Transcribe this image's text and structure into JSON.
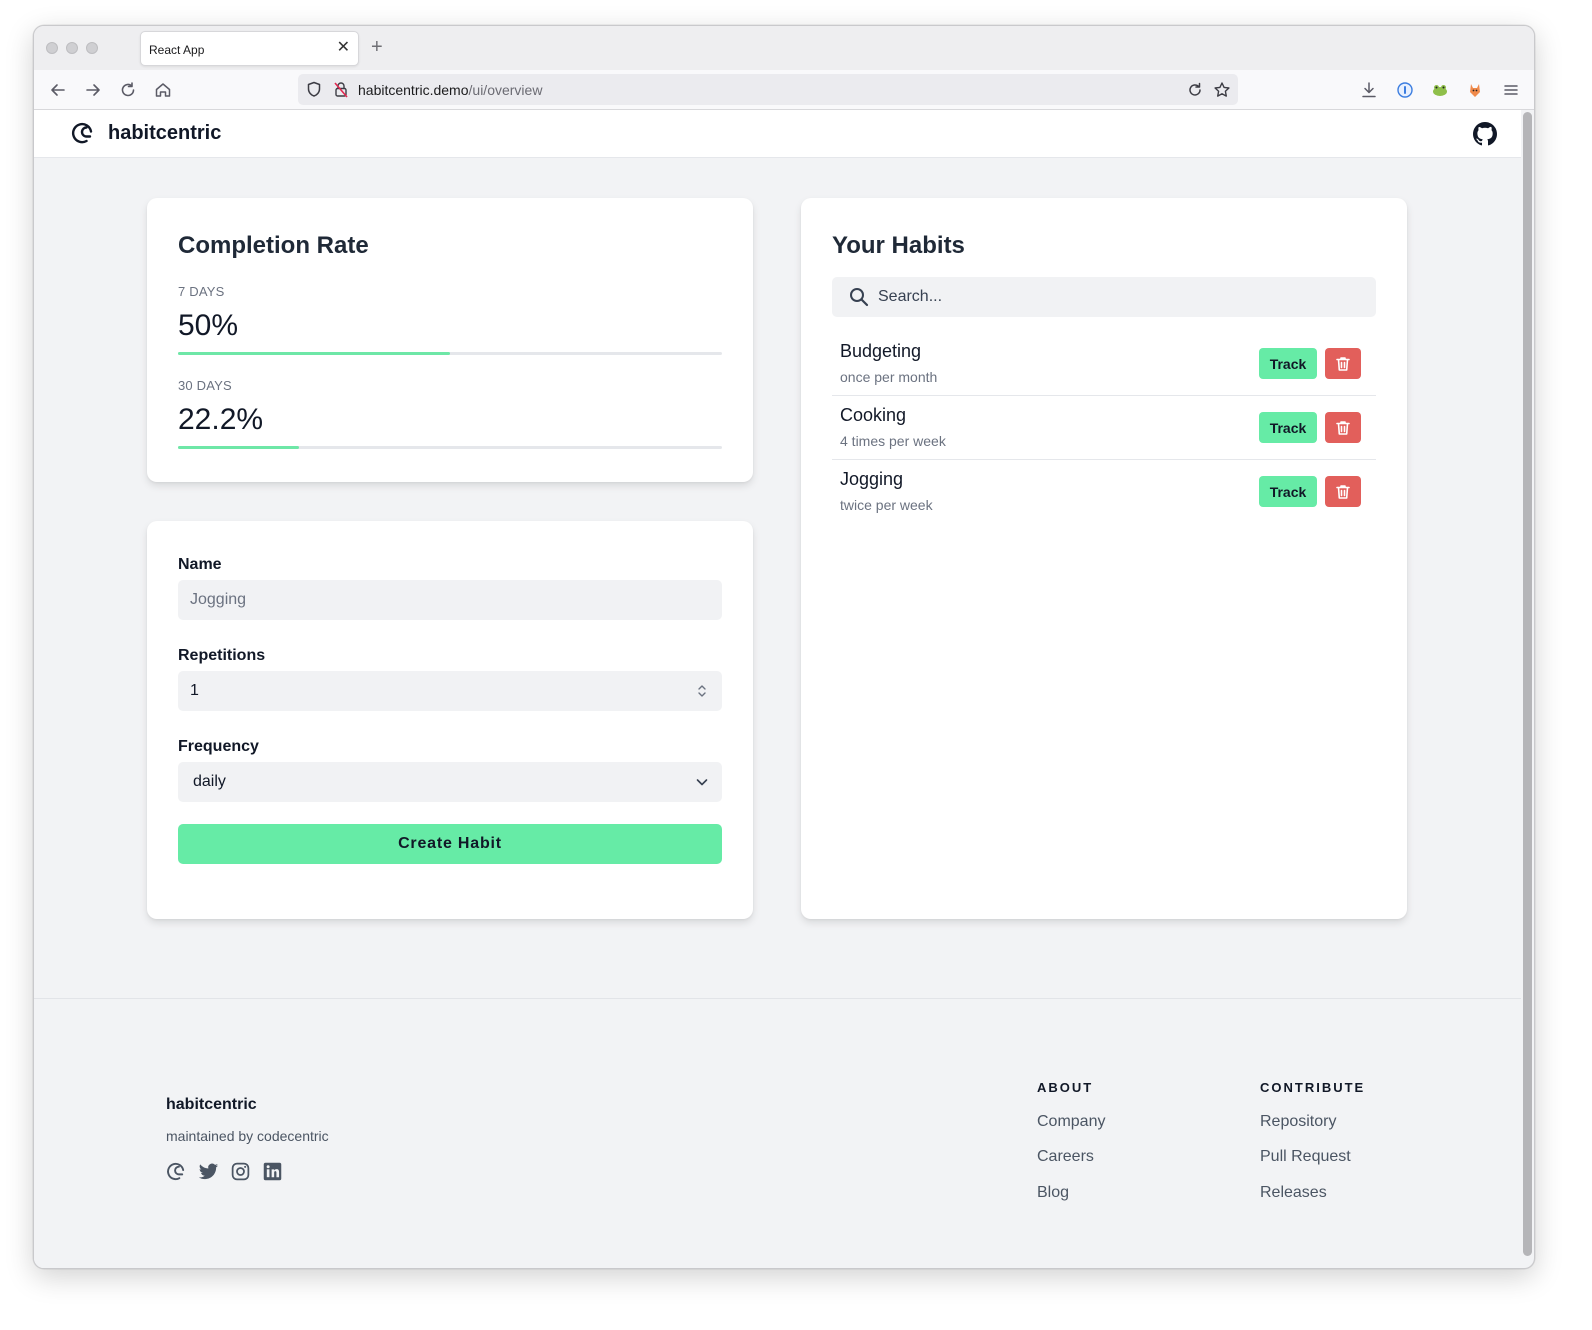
{
  "browser": {
    "tab_title": "React App",
    "tab_close": "✕",
    "new_tab": "+",
    "url_domain": "habitcentric.demo",
    "url_path": "/ui/overview"
  },
  "header": {
    "brand": "habitcentric"
  },
  "completion": {
    "title": "Completion Rate",
    "stats": [
      {
        "label": "7 DAYS",
        "value": "50%",
        "fill": 0.5
      },
      {
        "label": "30 DAYS",
        "value": "22.2%",
        "fill": 0.222
      }
    ]
  },
  "form": {
    "name_label": "Name",
    "name_placeholder": "Jogging",
    "repetitions_label": "Repetitions",
    "repetitions_value": "1",
    "frequency_label": "Frequency",
    "frequency_value": "daily",
    "submit_label": "Create Habit"
  },
  "habits": {
    "title": "Your Habits",
    "search_placeholder": "Search...",
    "track_label": "Track",
    "items": [
      {
        "name": "Budgeting",
        "frequency": "once per month"
      },
      {
        "name": "Cooking",
        "frequency": "4 times per week"
      },
      {
        "name": "Jogging",
        "frequency": "twice per week"
      }
    ]
  },
  "footer": {
    "brand": "habitcentric",
    "subtitle": "maintained by codecentric",
    "about_heading": "ABOUT",
    "about_links": [
      "Company",
      "Careers",
      "Blog"
    ],
    "contribute_heading": "CONTRIBUTE",
    "contribute_links": [
      "Repository",
      "Pull Request",
      "Releases"
    ]
  },
  "colors": {
    "accent_green": "#66eba6",
    "progress_green": "#6ee7a7",
    "danger_red": "#e25f5b"
  },
  "icons": [
    "habitcentric-logo-icon",
    "github-icon",
    "search-icon",
    "trash-icon",
    "chevron-down-icon",
    "twitter-icon",
    "instagram-icon",
    "linkedin-icon"
  ]
}
